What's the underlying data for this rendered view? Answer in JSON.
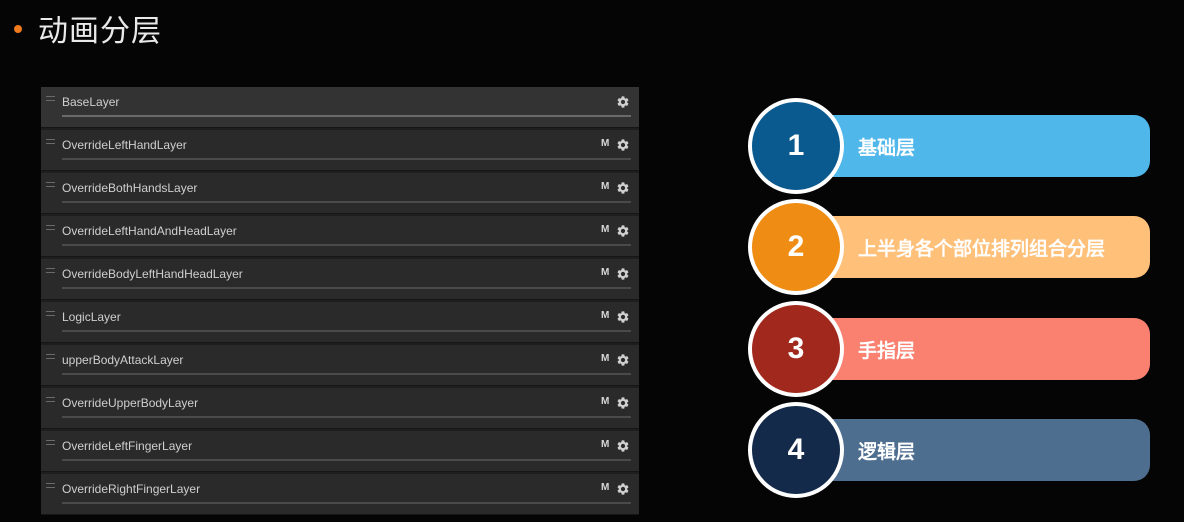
{
  "slide": {
    "title": "动画分层",
    "bullet_color": "#f07a1e"
  },
  "layers": [
    {
      "name": "BaseLayer",
      "mask": "",
      "selected": true
    },
    {
      "name": "OverrideLeftHandLayer",
      "mask": "M"
    },
    {
      "name": "OverrideBothHandsLayer",
      "mask": "M"
    },
    {
      "name": "OverrideLeftHandAndHeadLayer",
      "mask": "M"
    },
    {
      "name": "OverrideBodyLeftHandHeadLayer",
      "mask": "M"
    },
    {
      "name": "LogicLayer",
      "mask": "M"
    },
    {
      "name": "upperBodyAttackLayer",
      "mask": "M"
    },
    {
      "name": "OverrideUpperBodyLayer",
      "mask": "M"
    },
    {
      "name": "OverrideLeftFingerLayer",
      "mask": "M"
    },
    {
      "name": "OverrideRightFingerLayer",
      "mask": "M"
    }
  ],
  "legend": [
    {
      "number": "1",
      "label": "基础层",
      "circle_color": "#0b5a8f",
      "bar_color": "#4fb7ea"
    },
    {
      "number": "2",
      "label": "上半身各个部位排列组合分层",
      "circle_color": "#ef8c14",
      "bar_color": "#ffc07a"
    },
    {
      "number": "3",
      "label": "手指层",
      "circle_color": "#a0281c",
      "bar_color": "#fa8070"
    },
    {
      "number": "4",
      "label": "逻辑层",
      "circle_color": "#132a4a",
      "bar_color": "#4e6e90"
    }
  ]
}
